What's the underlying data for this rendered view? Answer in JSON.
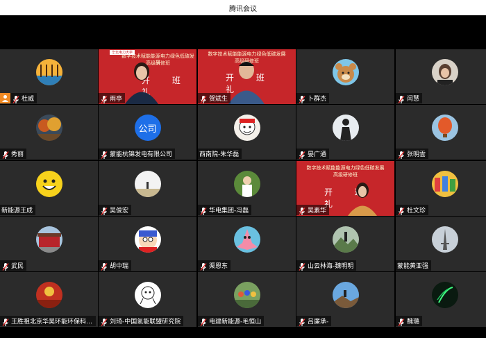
{
  "window": {
    "title": "腾讯会议"
  },
  "banner": {
    "line1": "数字技术赋能能源电力绿色低碳发展",
    "line2": "高级研修班",
    "opening": "开 班 礼",
    "university_logo": "华北电力大学"
  },
  "participants": [
    {
      "name": "杜威",
      "avatar": "orange-landscape",
      "host": true
    },
    {
      "name": "雨亭",
      "avatar": "video-woman"
    },
    {
      "name": "贺斌生",
      "avatar": "video-man"
    },
    {
      "name": "卜群杰",
      "avatar": "bear"
    },
    {
      "name": "闫慧",
      "avatar": "woman-glasses"
    },
    {
      "name": "秀丽",
      "avatar": "autumn-tree"
    },
    {
      "name": "蒙能杭锦发电有限公司",
      "avatar": "company",
      "avatar_text": "公司"
    },
    {
      "name": "西南院-朱华磊",
      "avatar": "cartoon",
      "muted_hidden": true
    },
    {
      "name": "晏广通",
      "avatar": "silhouette"
    },
    {
      "name": "张明雲",
      "avatar": "balloon"
    },
    {
      "name": "新能源王成",
      "avatar": "smiley",
      "muted_hidden": true
    },
    {
      "name": "吴俊宏",
      "avatar": "field"
    },
    {
      "name": "华电集团-冯磊",
      "avatar": "green-person"
    },
    {
      "name": "吴素华",
      "avatar": "video-woman2"
    },
    {
      "name": "杜文珍",
      "avatar": "colorful-people"
    },
    {
      "name": "武民",
      "avatar": "tiananmen"
    },
    {
      "name": "胡中瑞",
      "avatar": "southpark"
    },
    {
      "name": "渠恩东",
      "avatar": "patrick"
    },
    {
      "name": "山云林海-魏明明",
      "avatar": "mountain-person"
    },
    {
      "name": "蒙能黄亚强",
      "avatar": "eiffel",
      "muted_hidden": true
    },
    {
      "name": "王胜祖北京华昊环能环保科技...",
      "avatar": "red-wall"
    },
    {
      "name": "刘琦-中国氢能联盟研究院",
      "avatar": "doodle"
    },
    {
      "name": "电建新能源-毛恒山",
      "avatar": "crowd"
    },
    {
      "name": "吕廉承-",
      "avatar": "blue-sky"
    },
    {
      "name": "魏璐",
      "avatar": "green-light"
    }
  ],
  "colors": {
    "banner_red": "#c6262a",
    "tile_bg": "#2b2b2b",
    "host_orange": "#f08a24",
    "company_blue": "#1e6fe8"
  }
}
